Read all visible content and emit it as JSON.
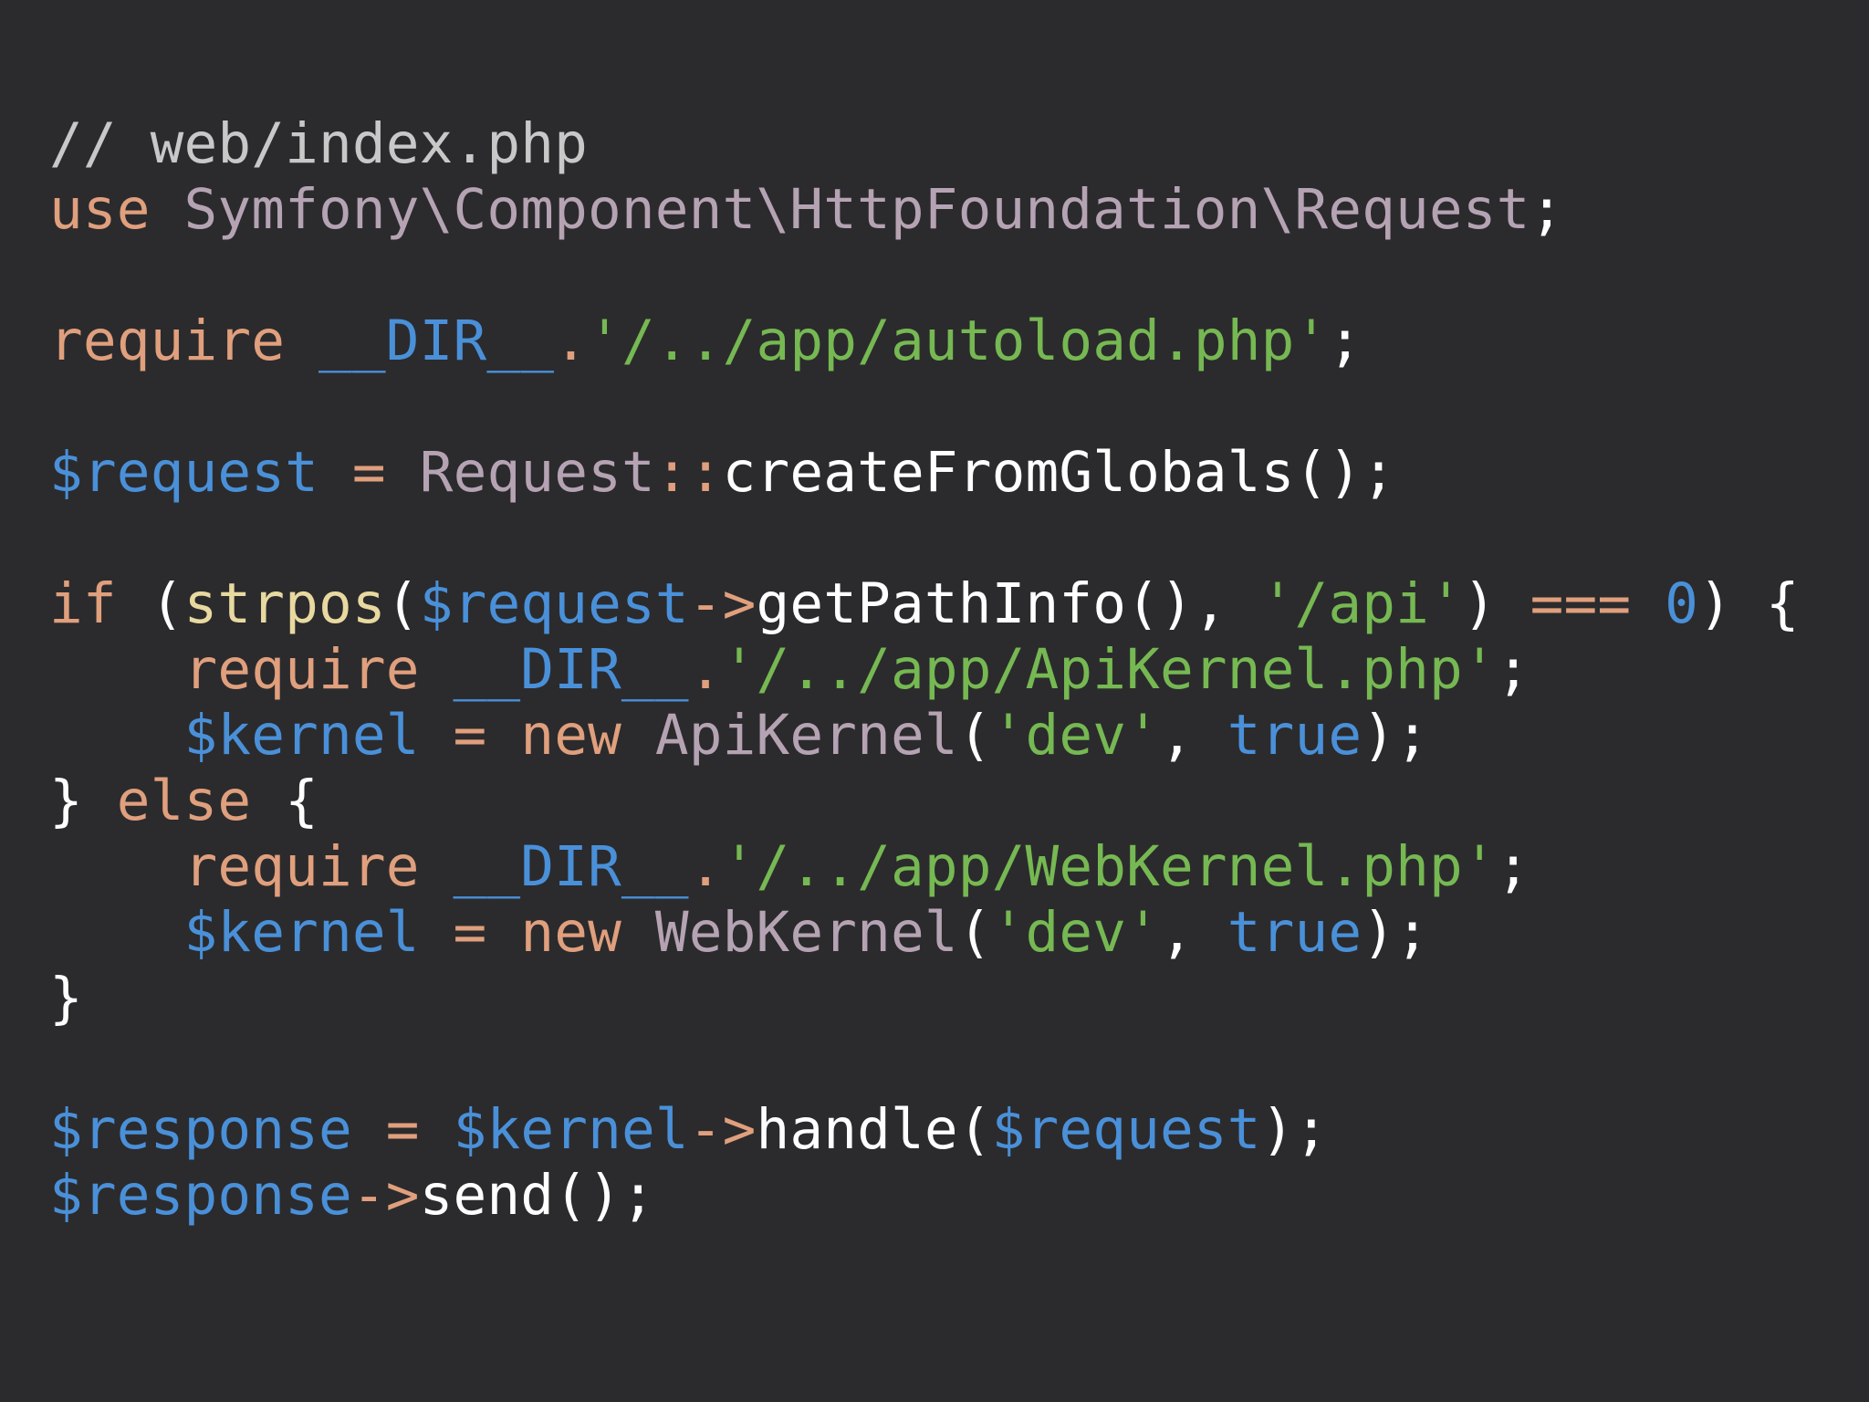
{
  "code_view": {
    "file_comment": "// web/index.php",
    "colors": {
      "background": "#2b2b2d",
      "comment": "#c8c8c8",
      "keyword": "#e09f7d",
      "class": "#b5a3b3",
      "plain": "#ffffff",
      "string": "#76b852",
      "variable": "#4a90d9",
      "constant": "#4a90d9",
      "function": "#e8d9a0"
    },
    "lines": [
      [
        {
          "text": "// web/index.php",
          "role": "comment"
        }
      ],
      [
        {
          "text": "use",
          "role": "keyword"
        },
        {
          "text": " ",
          "role": "plain"
        },
        {
          "text": "Symfony\\Component\\HttpFoundation\\Request",
          "role": "class"
        },
        {
          "text": ";",
          "role": "plain"
        }
      ],
      [],
      [
        {
          "text": "require",
          "role": "keyword"
        },
        {
          "text": " ",
          "role": "plain"
        },
        {
          "text": "__DIR__",
          "role": "constant"
        },
        {
          "text": ".",
          "role": "keyword"
        },
        {
          "text": "'/../app/autoload.php'",
          "role": "string"
        },
        {
          "text": ";",
          "role": "plain"
        }
      ],
      [],
      [
        {
          "text": "$request",
          "role": "variable"
        },
        {
          "text": " ",
          "role": "plain"
        },
        {
          "text": "=",
          "role": "keyword"
        },
        {
          "text": " ",
          "role": "plain"
        },
        {
          "text": "Request",
          "role": "class"
        },
        {
          "text": "::",
          "role": "keyword"
        },
        {
          "text": "createFromGlobals();",
          "role": "plain"
        }
      ],
      [],
      [
        {
          "text": "if",
          "role": "keyword"
        },
        {
          "text": " (",
          "role": "plain"
        },
        {
          "text": "strpos",
          "role": "function"
        },
        {
          "text": "(",
          "role": "plain"
        },
        {
          "text": "$request",
          "role": "variable"
        },
        {
          "text": "->",
          "role": "keyword"
        },
        {
          "text": "getPathInfo(), ",
          "role": "plain"
        },
        {
          "text": "'/api'",
          "role": "string"
        },
        {
          "text": ") ",
          "role": "plain"
        },
        {
          "text": "===",
          "role": "keyword"
        },
        {
          "text": " ",
          "role": "plain"
        },
        {
          "text": "0",
          "role": "constant"
        },
        {
          "text": ") {",
          "role": "plain"
        }
      ],
      [
        {
          "text": "    ",
          "role": "plain"
        },
        {
          "text": "require",
          "role": "keyword"
        },
        {
          "text": " ",
          "role": "plain"
        },
        {
          "text": "__DIR__",
          "role": "constant"
        },
        {
          "text": ".",
          "role": "keyword"
        },
        {
          "text": "'/../app/ApiKernel.php'",
          "role": "string"
        },
        {
          "text": ";",
          "role": "plain"
        }
      ],
      [
        {
          "text": "    ",
          "role": "plain"
        },
        {
          "text": "$kernel",
          "role": "variable"
        },
        {
          "text": " ",
          "role": "plain"
        },
        {
          "text": "=",
          "role": "keyword"
        },
        {
          "text": " ",
          "role": "plain"
        },
        {
          "text": "new",
          "role": "keyword"
        },
        {
          "text": " ",
          "role": "plain"
        },
        {
          "text": "ApiKernel",
          "role": "class"
        },
        {
          "text": "(",
          "role": "plain"
        },
        {
          "text": "'dev'",
          "role": "string"
        },
        {
          "text": ", ",
          "role": "plain"
        },
        {
          "text": "true",
          "role": "constant"
        },
        {
          "text": ");",
          "role": "plain"
        }
      ],
      [
        {
          "text": "} ",
          "role": "plain"
        },
        {
          "text": "else",
          "role": "keyword"
        },
        {
          "text": " {",
          "role": "plain"
        }
      ],
      [
        {
          "text": "    ",
          "role": "plain"
        },
        {
          "text": "require",
          "role": "keyword"
        },
        {
          "text": " ",
          "role": "plain"
        },
        {
          "text": "__DIR__",
          "role": "constant"
        },
        {
          "text": ".",
          "role": "keyword"
        },
        {
          "text": "'/../app/WebKernel.php'",
          "role": "string"
        },
        {
          "text": ";",
          "role": "plain"
        }
      ],
      [
        {
          "text": "    ",
          "role": "plain"
        },
        {
          "text": "$kernel",
          "role": "variable"
        },
        {
          "text": " ",
          "role": "plain"
        },
        {
          "text": "=",
          "role": "keyword"
        },
        {
          "text": " ",
          "role": "plain"
        },
        {
          "text": "new",
          "role": "keyword"
        },
        {
          "text": " ",
          "role": "plain"
        },
        {
          "text": "WebKernel",
          "role": "class"
        },
        {
          "text": "(",
          "role": "plain"
        },
        {
          "text": "'dev'",
          "role": "string"
        },
        {
          "text": ", ",
          "role": "plain"
        },
        {
          "text": "true",
          "role": "constant"
        },
        {
          "text": ");",
          "role": "plain"
        }
      ],
      [
        {
          "text": "}",
          "role": "plain"
        }
      ],
      [],
      [
        {
          "text": "$response",
          "role": "variable"
        },
        {
          "text": " ",
          "role": "plain"
        },
        {
          "text": "=",
          "role": "keyword"
        },
        {
          "text": " ",
          "role": "plain"
        },
        {
          "text": "$kernel",
          "role": "variable"
        },
        {
          "text": "->",
          "role": "keyword"
        },
        {
          "text": "handle(",
          "role": "plain"
        },
        {
          "text": "$request",
          "role": "variable"
        },
        {
          "text": ");",
          "role": "plain"
        }
      ],
      [
        {
          "text": "$response",
          "role": "variable"
        },
        {
          "text": "->",
          "role": "keyword"
        },
        {
          "text": "send();",
          "role": "plain"
        }
      ]
    ]
  }
}
